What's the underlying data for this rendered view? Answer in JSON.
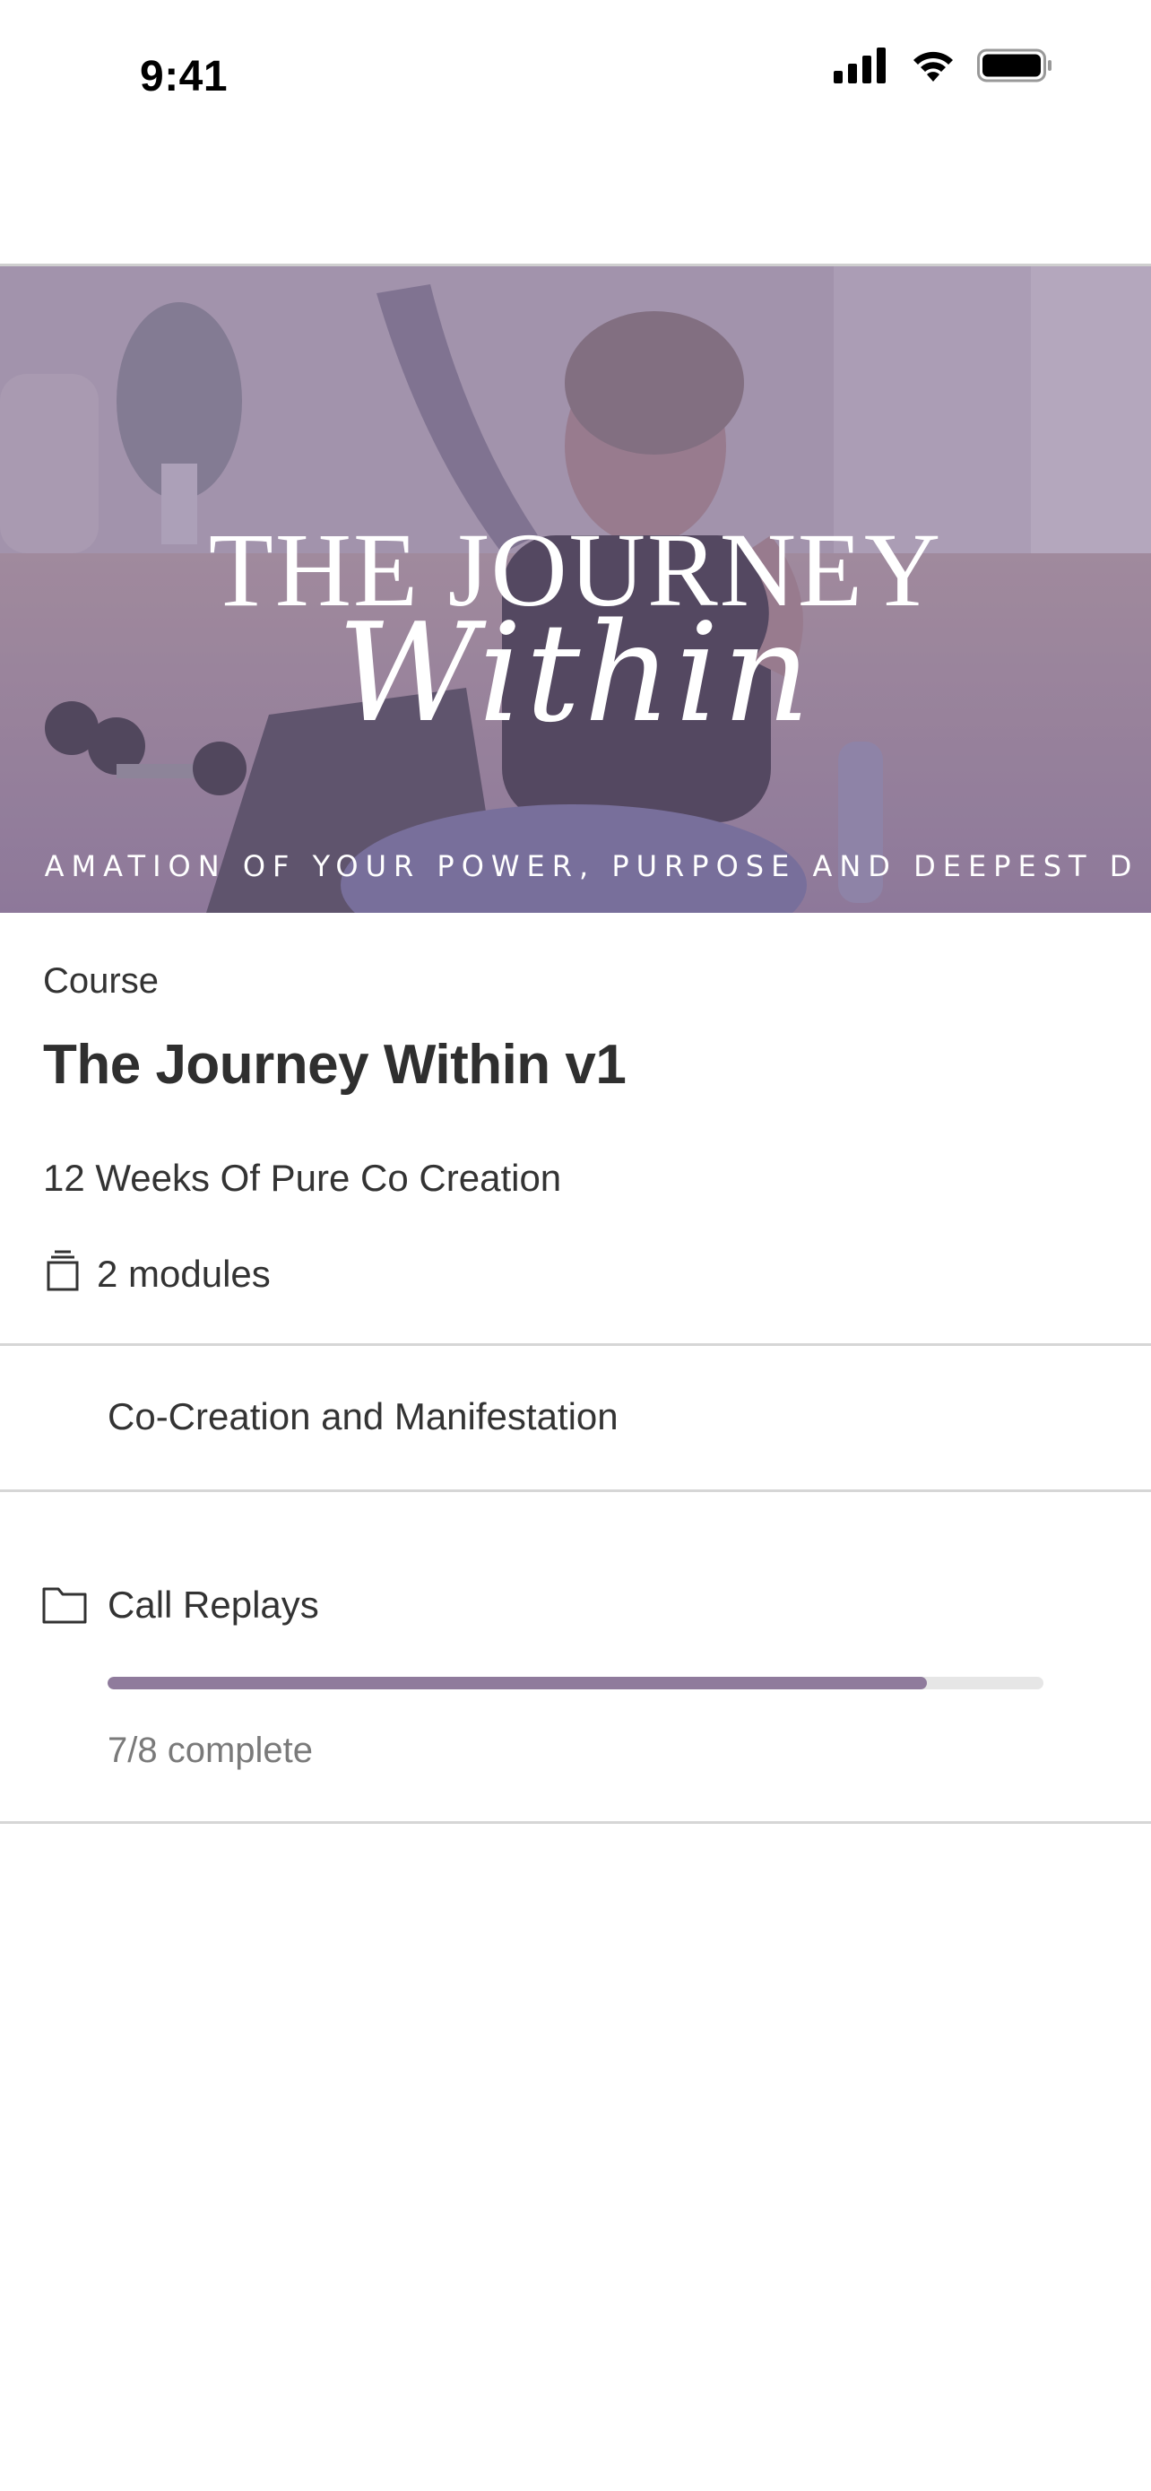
{
  "status_bar": {
    "time": "9:41"
  },
  "hero": {
    "title_line1": "THE JOURNEY",
    "title_line2": "Within",
    "tagline": "AMATION OF YOUR POWER, PURPOSE AND DEEPEST D"
  },
  "course": {
    "type_label": "Course",
    "title": "The Journey Within v1",
    "subtitle": "12 Weeks Of Pure Co Creation",
    "modules_count": "2 modules"
  },
  "modules": [
    {
      "label": "Co-Creation and Manifestation"
    },
    {
      "label": "Call Replays",
      "progress_fraction": 0.875,
      "progress_text": "7/8 complete"
    }
  ],
  "colors": {
    "hero_tint": "#8e7fa6",
    "progress_fill": "#8f7b9c",
    "progress_track": "#e6e6e6"
  },
  "icons": [
    "signal-icon",
    "wifi-icon",
    "battery-icon",
    "stack-icon",
    "folder-icon"
  ]
}
